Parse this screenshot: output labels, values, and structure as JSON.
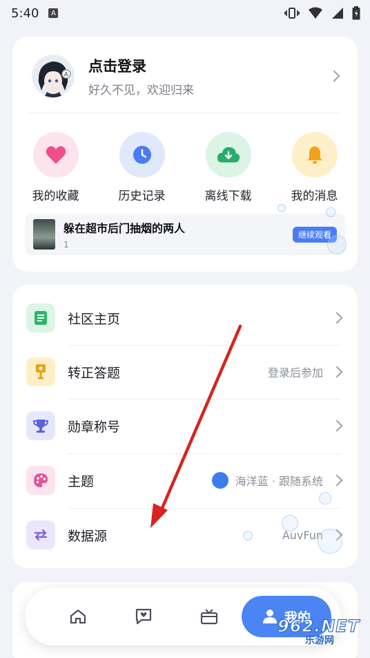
{
  "status_bar": {
    "time": "5:40",
    "notification_letter": "A"
  },
  "profile": {
    "title": "点击登录",
    "subtitle": "好久不见，欢迎归来"
  },
  "quick_actions": [
    {
      "label": "我的收藏",
      "icon": "heart-icon",
      "bg": "#fde3ec",
      "color": "#f04e8a"
    },
    {
      "label": "历史记录",
      "icon": "clock-icon",
      "bg": "#dfe9fb",
      "color": "#4a7cf4"
    },
    {
      "label": "离线下载",
      "icon": "cloud-download-icon",
      "bg": "#dbf4e6",
      "color": "#27ae6a"
    },
    {
      "label": "我的消息",
      "icon": "bell-icon",
      "bg": "#fdf0c9",
      "color": "#f2a31b"
    }
  ],
  "history_card": {
    "title": "躲在超市后门抽烟的两人",
    "episode": "1",
    "action": "继续观看"
  },
  "menu": [
    {
      "label": "社区主页",
      "value": "",
      "icon": "document-icon",
      "bg": "#dcf5e6",
      "color": "#2fb56c"
    },
    {
      "label": "转正答题",
      "value": "登录后参加",
      "icon": "badge-icon",
      "bg": "#fdf0c9",
      "color": "#e8a21c"
    },
    {
      "label": "勋章称号",
      "value": "",
      "icon": "trophy-icon",
      "bg": "#e5e7fb",
      "color": "#5b63d9"
    },
    {
      "label": "主题",
      "value": "海洋蓝 · 跟随系统",
      "icon": "palette-icon",
      "bg": "#fde3ee",
      "color": "#e0559a"
    },
    {
      "label": "数据源",
      "value": "AuvFun",
      "icon": "swap-icon",
      "bg": "#ebe6fb",
      "color": "#7b61d6"
    }
  ],
  "tabbar": {
    "active_label": "我的",
    "tabs": [
      "home-icon",
      "chat-heart-icon",
      "tv-icon",
      "user-icon"
    ]
  },
  "watermark": {
    "top": "962.NET",
    "bottom": "乐游网"
  }
}
